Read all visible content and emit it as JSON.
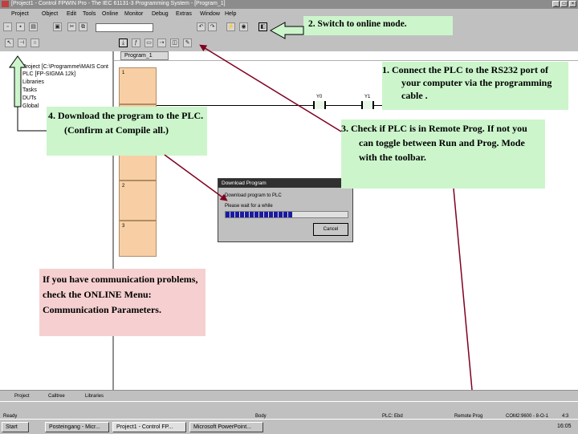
{
  "window": {
    "title": "[Project1 - Control FPWIN Pro - The IEC 61131-3 Programming System - [Program_1]"
  },
  "menu": {
    "items": [
      "Project",
      "Object",
      "Edit",
      "Tools",
      "Online",
      "Monitor",
      "Debug",
      "Extras",
      "Window",
      "Help"
    ]
  },
  "tree": {
    "items": [
      "Project [C:\\Programme\\MAIS Cont",
      "PLC [FP-SIGMA 12k]",
      "Libraries",
      "Tasks",
      "DUTs",
      "Global"
    ]
  },
  "editor": {
    "tab": "Program_1",
    "rungs": [
      "1",
      "",
      "2",
      "3"
    ],
    "contacts": [
      "Y0",
      "Y1"
    ]
  },
  "dialog": {
    "title": "Download Program",
    "message": "Download program to PLC",
    "wait": "Please wait for a while",
    "cancel": "Cancel",
    "progress": 0.55
  },
  "callouts": {
    "switch_online": "2. Switch to online mode.",
    "connect_plc": "1. Connect the PLC to the RS232 port of your computer via the programming cable .",
    "check_remote": "3. Check if PLC is in Remote Prog. If not you can toggle between Run and Prog. Mode with the toolbar.",
    "download": "4. Download the program to the PLC. (Confirm at Compile all.)",
    "comm_problems": "If you have communication problems, check the ONLINE Menu: Communication Parameters."
  },
  "bottom_tabs": [
    "Project",
    "Calltree",
    "Libraries"
  ],
  "status": {
    "ready": "Ready",
    "body": "Body",
    "plc": "PLC: Ebd",
    "mode": "Remote Prog",
    "port": "COM2:9600 - 8-O-1",
    "pos": "4:3"
  },
  "taskbar": {
    "start": "Start",
    "tasks": [
      "Posteingang - Micr...",
      "Project1 - Control FP...",
      "Microsoft PowerPoint..."
    ],
    "clock": "16:05"
  },
  "colors": {
    "callout_green": "#ccf5cc",
    "callout_pink": "#f6d0d0",
    "rung_fill": "#f8cfa4",
    "progress_fill": "#1a1aa0"
  }
}
